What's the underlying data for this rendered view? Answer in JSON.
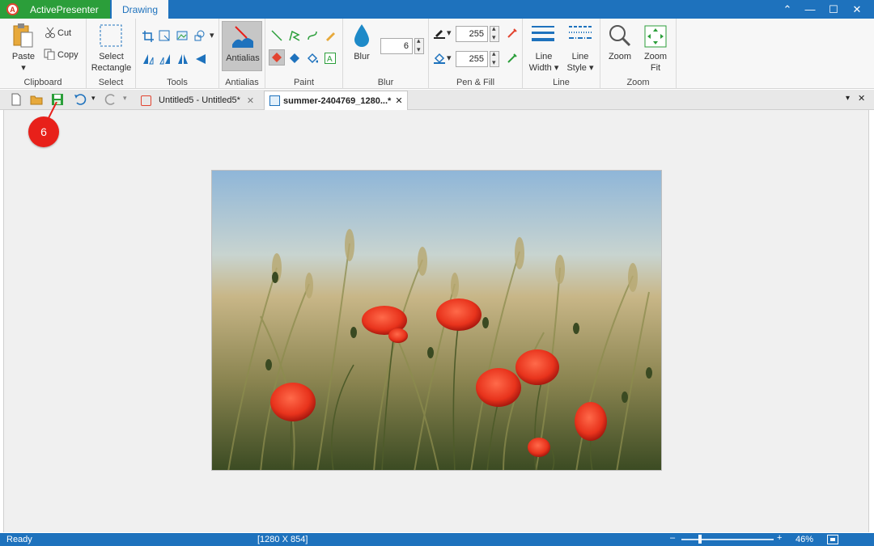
{
  "titlebar": {
    "app_name": "ActivePresenter",
    "active_tab": "Drawing"
  },
  "ribbon": {
    "clipboard": {
      "label": "Clipboard",
      "paste": "Paste",
      "cut": "Cut",
      "copy": "Copy"
    },
    "select": {
      "label": "Select",
      "select_rect_line1": "Select",
      "select_rect_line2": "Rectangle"
    },
    "tools": {
      "label": "Tools"
    },
    "antialias": {
      "label": "Antialias",
      "button": "Antialias"
    },
    "paint": {
      "label": "Paint"
    },
    "blur": {
      "label": "Blur",
      "button": "Blur",
      "value": "6"
    },
    "pen_fill": {
      "label": "Pen & Fill",
      "pen_value": "255",
      "fill_value": "255"
    },
    "line": {
      "label": "Line",
      "width_line1": "Line",
      "width_line2": "Width",
      "style_line1": "Line",
      "style_line2": "Style"
    },
    "zoom": {
      "label": "Zoom",
      "zoom": "Zoom",
      "zoom_fit_line1": "Zoom",
      "zoom_fit_line2": "Fit"
    }
  },
  "tabs": [
    {
      "label": "Untitled5 - Untitled5*",
      "active": false
    },
    {
      "label": "summer-2404769_1280...*",
      "active": true
    }
  ],
  "step_badge": "6",
  "statusbar": {
    "status": "Ready",
    "dimensions": "[1280 X 854]",
    "zoom_level": "46%",
    "zoom_fraction": 0.46
  },
  "colors": {
    "title_blue": "#1e72bd",
    "app_green": "#2b9e3a",
    "badge_red": "#e8201a"
  }
}
